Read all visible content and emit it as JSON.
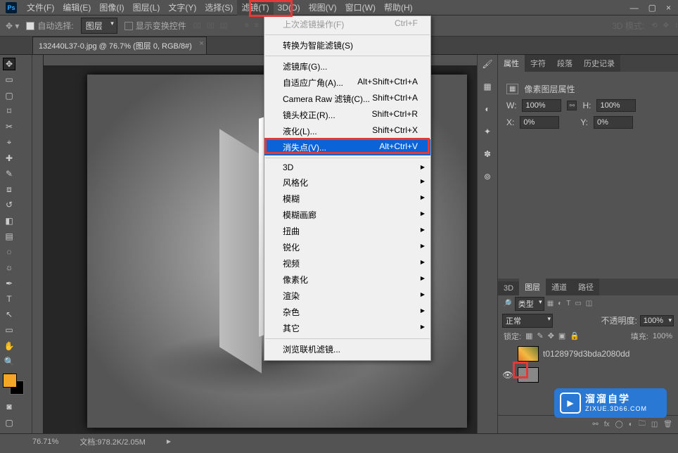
{
  "menubar": {
    "items": [
      "文件(F)",
      "编辑(E)",
      "图像(I)",
      "图层(L)",
      "文字(Y)",
      "选择(S)",
      "滤镜(T)",
      "3D(D)",
      "视图(V)",
      "窗口(W)",
      "帮助(H)"
    ],
    "highlighted_index": 6
  },
  "window_controls": {
    "min": "—",
    "max": "▢",
    "close": "×"
  },
  "optionsbar": {
    "auto_select": "自动选择:",
    "layer_select": "图层",
    "show_transform": "显示变换控件",
    "mode_3d": "3D 模式:"
  },
  "document": {
    "tab_title": "132440L37-0.jpg @ 76.7% (图层 0, RGB/8#)"
  },
  "dropdown": {
    "last_filter": {
      "label": "上次滤镜操作(F)",
      "short": "Ctrl+F",
      "disabled": true
    },
    "smart": {
      "label": "转换为智能滤镜(S)"
    },
    "gallery": {
      "label": "滤镜库(G)..."
    },
    "adaptive": {
      "label": "自适应广角(A)...",
      "short": "Alt+Shift+Ctrl+A"
    },
    "camera": {
      "label": "Camera Raw 滤镜(C)...",
      "short": "Shift+Ctrl+A"
    },
    "lens": {
      "label": "镜头校正(R)...",
      "short": "Shift+Ctrl+R"
    },
    "liquify": {
      "label": "液化(L)...",
      "short": "Shift+Ctrl+X"
    },
    "vanish": {
      "label": "消失点(V)...",
      "short": "Alt+Ctrl+V"
    },
    "sub_3d": {
      "label": "3D"
    },
    "sub_stylize": {
      "label": "风格化"
    },
    "sub_blur": {
      "label": "模糊"
    },
    "sub_blurg": {
      "label": "模糊画廊"
    },
    "sub_distort": {
      "label": "扭曲"
    },
    "sub_sharpen": {
      "label": "锐化"
    },
    "sub_video": {
      "label": "视频"
    },
    "sub_pixel": {
      "label": "像素化"
    },
    "sub_render": {
      "label": "渲染"
    },
    "sub_other": {
      "label": "杂色"
    },
    "sub_misc": {
      "label": "其它"
    },
    "browse": {
      "label": "浏览联机滤镜..."
    }
  },
  "panels": {
    "tabs": [
      "属性",
      "字符",
      "段落",
      "历史记录"
    ],
    "props_title": "像素图层属性",
    "W": "W:",
    "H": "H:",
    "X": "X:",
    "Y": "Y:",
    "w_val": "100%",
    "h_val": "100%",
    "x_val": "0%",
    "y_val": "0%"
  },
  "layers": {
    "tabs": [
      "3D",
      "图层",
      "通道",
      "路径"
    ],
    "kind": "类型",
    "blend": "正常",
    "opacity_lbl": "不透明度:",
    "opacity_val": "100%",
    "lock_lbl": "锁定:",
    "fill_lbl": "填充:",
    "fill_val": "100%",
    "layer_name": "t0128979d3bda2080dd"
  },
  "statusbar": {
    "zoom": "76.71%",
    "doc": "文档:978.2K/2.05M"
  },
  "watermark": {
    "t1": "溜溜自学",
    "t2": "ZIXUE.3D66.COM"
  }
}
